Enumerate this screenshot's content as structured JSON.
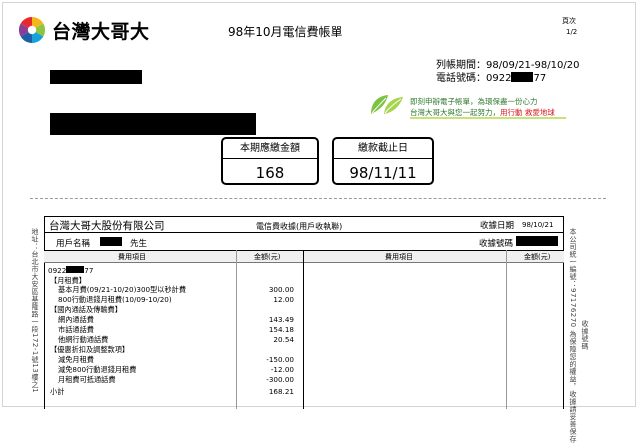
{
  "header": {
    "brand_name": "台灣大哥大",
    "bill_title": "98年10月電信費帳單",
    "page_label": "頁次",
    "page_number": "1/2",
    "logo_icon": "rainbow-globe-icon"
  },
  "customer": {
    "period_label": "列帳期間：",
    "period_value": "98/09/21-98/10/20",
    "phone_label": "電話號碼：",
    "phone_prefix": "0922",
    "phone_suffix": "77"
  },
  "ebill_banner": {
    "icon": "green-leaf-icon",
    "line1": "即刻申辦電子帳單，為環保盡一份心力",
    "line2_prefix": "台灣大哥大與您一起努力，",
    "line2_highlight": "用行動 救愛地球",
    "highlight_color": "#d9181e",
    "text_color": "#2f7a2f"
  },
  "amount_due": {
    "label": "本期應繳金額",
    "value": "168"
  },
  "due_date": {
    "label": "繳款截止日",
    "value": "98/11/11"
  },
  "receipt": {
    "company": "台灣大哥大股份有限公司",
    "type": "電信費收據(用戶收執聯)",
    "date_label": "收據日期",
    "date_value": "98/10/21",
    "name_label": "用戶名稱",
    "name_suffix": "先生",
    "receipt_no_label": "收據號碼",
    "col_item": "費用項目",
    "col_amount": "金額(元)",
    "phone_prefix": "0922",
    "phone_suffix": "77"
  },
  "line_items": [
    {
      "label": "【月租費】",
      "amount": ""
    },
    {
      "label": "基本月費(09/21-10/20)300型以秒計費",
      "amount": "300.00"
    },
    {
      "label": "800行動退錢月租費(10/09-10/20)",
      "amount": "12.00"
    },
    {
      "label": "【國內通話及傳輸費】",
      "amount": ""
    },
    {
      "label": "網內通話費",
      "amount": "143.49"
    },
    {
      "label": "市話通話費",
      "amount": "154.18"
    },
    {
      "label": "他網行動通話費",
      "amount": "20.54"
    },
    {
      "label": "【優惠折扣及調整款項】",
      "amount": ""
    },
    {
      "label": "減免月租費",
      "amount": "-150.00"
    },
    {
      "label": "減免800行動退錢月租費",
      "amount": "-12.00"
    },
    {
      "label": "月租費可抵通話費",
      "amount": "-300.00"
    },
    {
      "label": "小計",
      "amount": "168.21"
    }
  ],
  "side_left": "地址：台北市大安區基隆路一段172-1號13樓之1",
  "side_right_1": "本公司統一編號：97176270 為保障您的權益，收據請妥善保存",
  "side_right_2": "收據號碼"
}
